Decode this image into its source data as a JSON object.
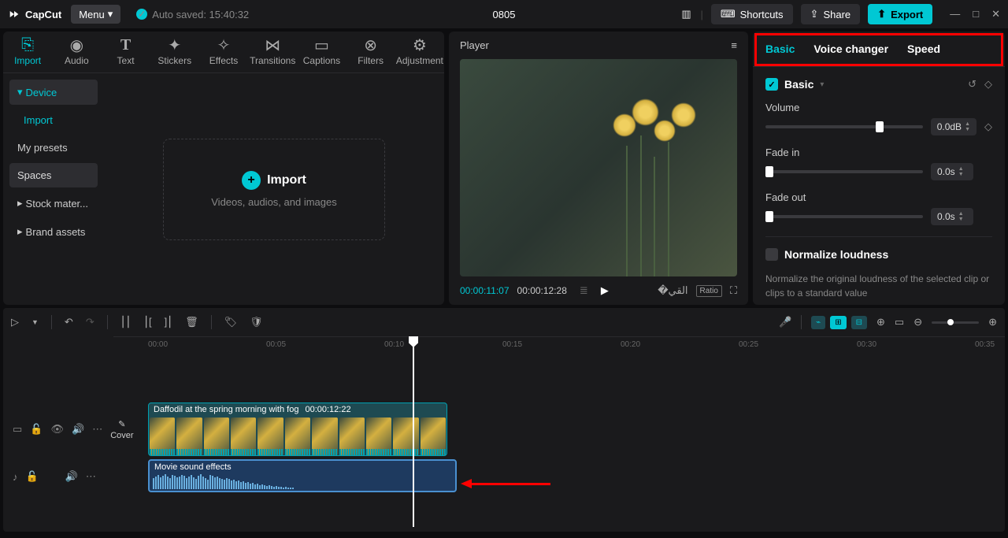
{
  "titlebar": {
    "logo": "CapCut",
    "menu": "Menu",
    "autosave": "Auto saved: 15:40:32",
    "project_title": "0805",
    "shortcuts": "Shortcuts",
    "share": "Share",
    "export": "Export"
  },
  "media_tabs": [
    {
      "label": "Import",
      "icon": "⎘"
    },
    {
      "label": "Audio",
      "icon": "◉"
    },
    {
      "label": "Text",
      "icon": "T"
    },
    {
      "label": "Stickers",
      "icon": "✦"
    },
    {
      "label": "Effects",
      "icon": "✧"
    },
    {
      "label": "Transitions",
      "icon": "⋈"
    },
    {
      "label": "Captions",
      "icon": "▭"
    },
    {
      "label": "Filters",
      "icon": "⊗"
    },
    {
      "label": "Adjustment",
      "icon": "⚙"
    }
  ],
  "left_sidebar": {
    "device": "Device",
    "import": "Import",
    "presets": "My presets",
    "spaces": "Spaces",
    "stock": "Stock mater...",
    "brand": "Brand assets"
  },
  "import_box": {
    "title": "Import",
    "sub": "Videos, audios, and images"
  },
  "player": {
    "title": "Player",
    "current": "00:00:11:07",
    "total": "00:00:12:28",
    "ratio": "Ratio"
  },
  "right_tabs": [
    "Basic",
    "Voice changer",
    "Speed"
  ],
  "basic": {
    "title": "Basic",
    "volume_label": "Volume",
    "volume_value": "0.0dB",
    "fadein_label": "Fade in",
    "fadein_value": "0.0s",
    "fadeout_label": "Fade out",
    "fadeout_value": "0.0s",
    "normalize_title": "Normalize loudness",
    "normalize_desc": "Normalize the original loudness of the selected clip or clips to a standard value"
  },
  "ruler": [
    "00:00",
    "00:05",
    "00:10",
    "00:15",
    "00:20",
    "00:25",
    "00:30",
    "00:35"
  ],
  "video_clip": {
    "name": "Daffodil at the spring morning with fog",
    "dur": "00:00:12:22"
  },
  "audio_clip": {
    "name": "Movie sound effects"
  },
  "cover": "Cover"
}
